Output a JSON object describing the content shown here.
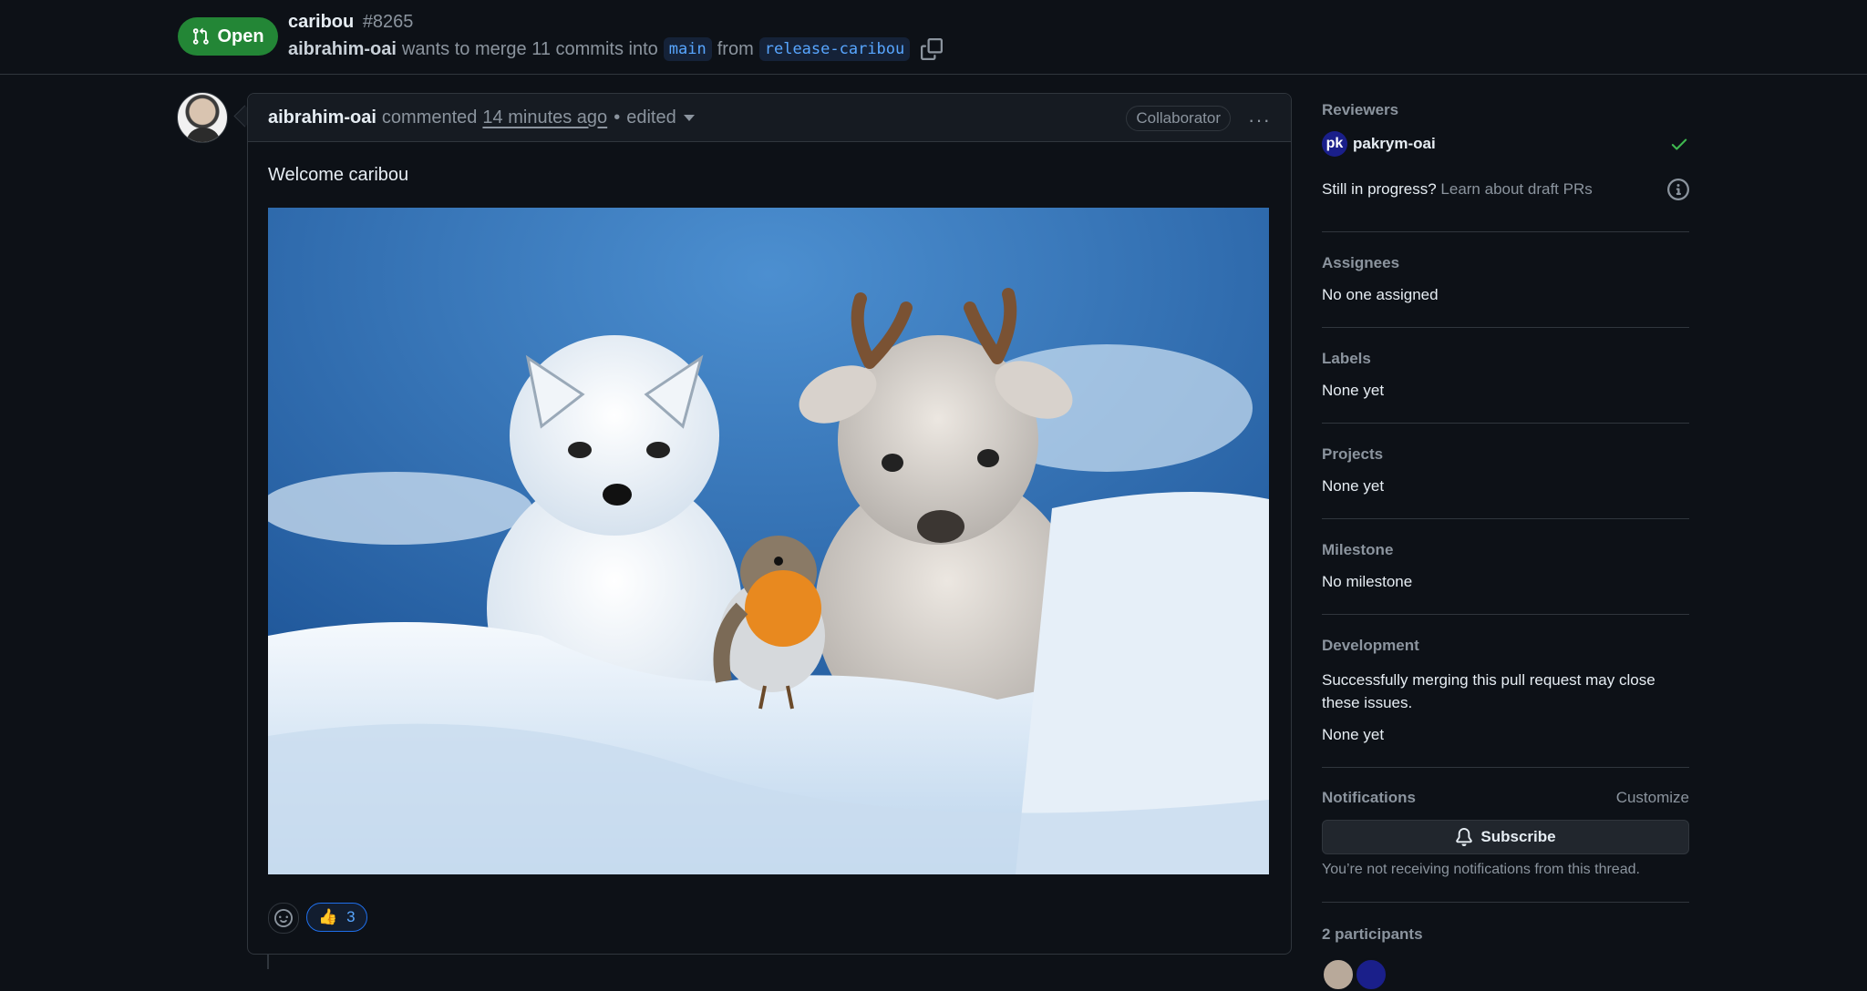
{
  "pr": {
    "state": "Open",
    "title": "caribou",
    "number": "#8265",
    "author": "aibrahim-oai",
    "merge_text": "wants to merge 11 commits into",
    "base_branch": "main",
    "from_text": "from",
    "head_branch": "release-caribou"
  },
  "comment": {
    "author": "aibrahim-oai",
    "action": "commented",
    "time": "14 minutes ago",
    "separator": "•",
    "edited": "edited",
    "role": "Collaborator",
    "body": "Welcome caribou",
    "reactions": [
      {
        "emoji": "👍",
        "count": "3"
      }
    ]
  },
  "sidebar": {
    "reviewers": {
      "heading": "Reviewers",
      "name": "pakrym-oai",
      "avatar_initials": "pk"
    },
    "draft": {
      "question": "Still in progress?",
      "link": "Learn about draft PRs"
    },
    "assignees": {
      "heading": "Assignees",
      "value": "No one assigned"
    },
    "labels": {
      "heading": "Labels",
      "value": "None yet"
    },
    "projects": {
      "heading": "Projects",
      "value": "None yet"
    },
    "milestone": {
      "heading": "Milestone",
      "value": "No milestone"
    },
    "development": {
      "heading": "Development",
      "description": "Successfully merging this pull request may close these issues.",
      "value": "None yet"
    },
    "notifications": {
      "heading": "Notifications",
      "customize": "Customize",
      "subscribe": "Subscribe",
      "note": "You’re not receiving notifications from this thread."
    },
    "participants": {
      "heading": "2 participants"
    }
  },
  "colors": {
    "open_green": "#238636",
    "link_blue": "#58a6ff",
    "background": "#0d1117",
    "border": "#30363d"
  }
}
